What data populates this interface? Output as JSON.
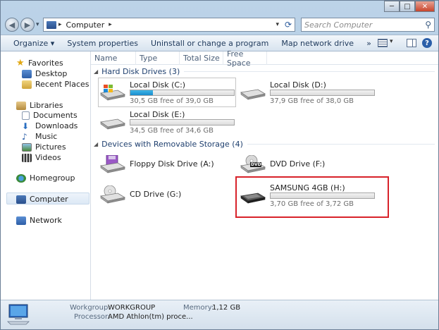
{
  "window": {
    "minimize": "─",
    "maximize": "□",
    "close": "✕"
  },
  "address": {
    "segment": "Computer",
    "arrow_left": "▸",
    "arrow_right": "▸",
    "dropdown": "▾",
    "refresh": "⟳"
  },
  "search": {
    "placeholder": "Search Computer"
  },
  "toolbar": {
    "organize": "Organize ▾",
    "system_properties": "System properties",
    "uninstall": "Uninstall or change a program",
    "map_network": "Map network drive",
    "more": "»"
  },
  "nav": {
    "favorites": "Favorites",
    "desktop": "Desktop",
    "recent_places": "Recent Places",
    "libraries": "Libraries",
    "documents": "Documents",
    "downloads": "Downloads",
    "music": "Music",
    "pictures": "Pictures",
    "videos": "Videos",
    "homegroup": "Homegroup",
    "computer": "Computer",
    "network": "Network"
  },
  "columns": {
    "name": "Name",
    "type": "Type",
    "total_size": "Total Size",
    "free_space": "Free Space"
  },
  "groups": {
    "hard_disk": "Hard Disk Drives (3)",
    "removable": "Devices with Removable Storage (4)"
  },
  "drives": {
    "c": {
      "name": "Local Disk (C:)",
      "free": "30,5 GB free of 39,0 GB",
      "used_fraction": 0.22
    },
    "d": {
      "name": "Local Disk (D:)",
      "free": "37,9 GB free of 38,0 GB",
      "used_fraction": 0.0
    },
    "e": {
      "name": "Local Disk (E:)",
      "free": "34,5 GB free of 34,6 GB",
      "used_fraction": 0.0
    },
    "floppy": {
      "name": "Floppy Disk Drive (A:)"
    },
    "dvd": {
      "name": "DVD Drive (F:)",
      "label": "DVD"
    },
    "cd": {
      "name": "CD Drive (G:)"
    },
    "samsung": {
      "name": "SAMSUNG 4GB (H:)",
      "free": "3,70 GB free of 3,72 GB",
      "used_fraction": 0.0
    }
  },
  "details": {
    "workgroup_label": "Workgroup:",
    "workgroup_value": "WORKGROUP",
    "memory_label": "Memory:",
    "memory_value": "1,12 GB",
    "processor_label": "Processor:",
    "processor_value": "AMD Athlon(tm) proce..."
  },
  "colors": {
    "highlight": "#d8222a",
    "bar_fill": "#26a0dc"
  }
}
